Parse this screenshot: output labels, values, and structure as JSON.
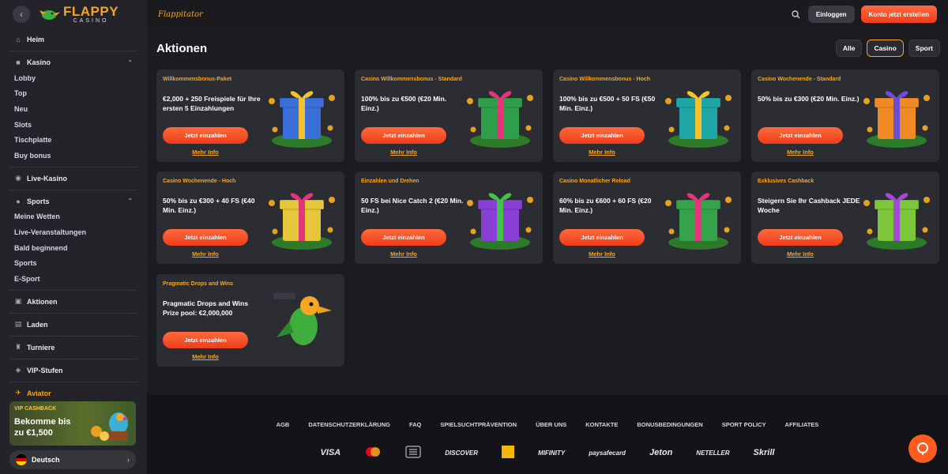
{
  "header": {
    "brand_script": "Flappitator",
    "login_label": "Einloggen",
    "register_label": "Konto jetzt erstellen"
  },
  "logo": {
    "main": "FLAPPY",
    "sub": "CASINO"
  },
  "sidebar": {
    "home": "Heim",
    "casino": "Kasino",
    "casino_items": [
      "Lobby",
      "Top",
      "Neu",
      "Slots",
      "Tischplatte",
      "Buy bonus"
    ],
    "live_casino": "Live-Kasino",
    "sports": "Sports",
    "sports_items": [
      "Meine Wetten",
      "Live-Veranstaltungen",
      "Bald beginnend",
      "Sports",
      "E-Sport"
    ],
    "promotions": "Aktionen",
    "shop": "Laden",
    "tournaments": "Turniere",
    "vip": "VIP-Stufen",
    "aviator": "Aviator",
    "vip_banner": {
      "tag": "VIP CASHBACK",
      "line1": "Bekomme bis",
      "line2": "zu €1,500"
    },
    "language": "Deutsch"
  },
  "main": {
    "title": "Aktionen",
    "filters": [
      "Alle",
      "Casino",
      "Sport"
    ],
    "active_filter": "Casino",
    "cta_label": "Jetzt einzahlen",
    "more_label": "Mehr Info",
    "cards": [
      {
        "title": "Willkommensbonus-Paket",
        "desc": "€2,000 + 250 Freispiele für Ihre ersten 5 Einzahlungen",
        "gift": "#3b6fd8",
        "ribbon": "#f2c230"
      },
      {
        "title": "Casino Willkommensbonus - Standard",
        "desc": "100% bis zu €500 (€20 Min. Einz.)",
        "gift": "#2f9e4a",
        "ribbon": "#e5357a"
      },
      {
        "title": "Casino Willkommensbonus - Hoch",
        "desc": "100% bis zu €500 + 50 FS (€50 Min. Einz.)",
        "gift": "#1fa7a8",
        "ribbon": "#f2c230"
      },
      {
        "title": "Casino Wochenende - Standard",
        "desc": "50% bis zu €300 (€20 Min. Einz.)",
        "gift": "#f08a24",
        "ribbon": "#6a4ed8"
      },
      {
        "title": "Casino Wochenende - Hoch",
        "desc": "50% bis zu €300 + 40 FS (€40 Min. Einz.)",
        "gift": "#e6c63a",
        "ribbon": "#e5357a"
      },
      {
        "title": "Einzahlen und Drehen",
        "desc": "50 FS bei Nice Catch 2 (€20 Min. Einz.)",
        "gift": "#8a3fd6",
        "ribbon": "#43c24a"
      },
      {
        "title": "Casino Monatlicher Reload",
        "desc": "60% bis zu €600 + 60 FS (€20 Min. Einz.)",
        "gift": "#35a34a",
        "ribbon": "#e5357a"
      },
      {
        "title": "Exklusives Cashback",
        "desc": "Steigern Sie Ihr Cashback JEDE Woche",
        "gift": "#7cc63a",
        "ribbon": "#a04ad8"
      },
      {
        "title": "Pragmatic Drops and Wins",
        "desc": "Pragmatic Drops and Wins Prize pool: €2,000,000",
        "gift": "",
        "ribbon": ""
      }
    ]
  },
  "footer": {
    "links": [
      "AGB",
      "DATENSCHUTZERKLÄRUNG",
      "FAQ",
      "SPIELSUCHTPRÄVENTION",
      "ÜBER UNS",
      "KONTAKTE",
      "BONUSBEDINGUNGEN",
      "SPORT POLICY",
      "AFFILIATES"
    ],
    "payments": [
      "VISA",
      "mastercard",
      "sepa",
      "DISCOVER",
      "interac",
      "MIFINITY",
      "paysafecard",
      "Jeton",
      "NETELLER",
      "Skrill"
    ]
  },
  "colors": {
    "accent": "#f6a623",
    "cta": "#ef3c1a",
    "card": "#2c2c33",
    "bg": "#1b1b20"
  }
}
